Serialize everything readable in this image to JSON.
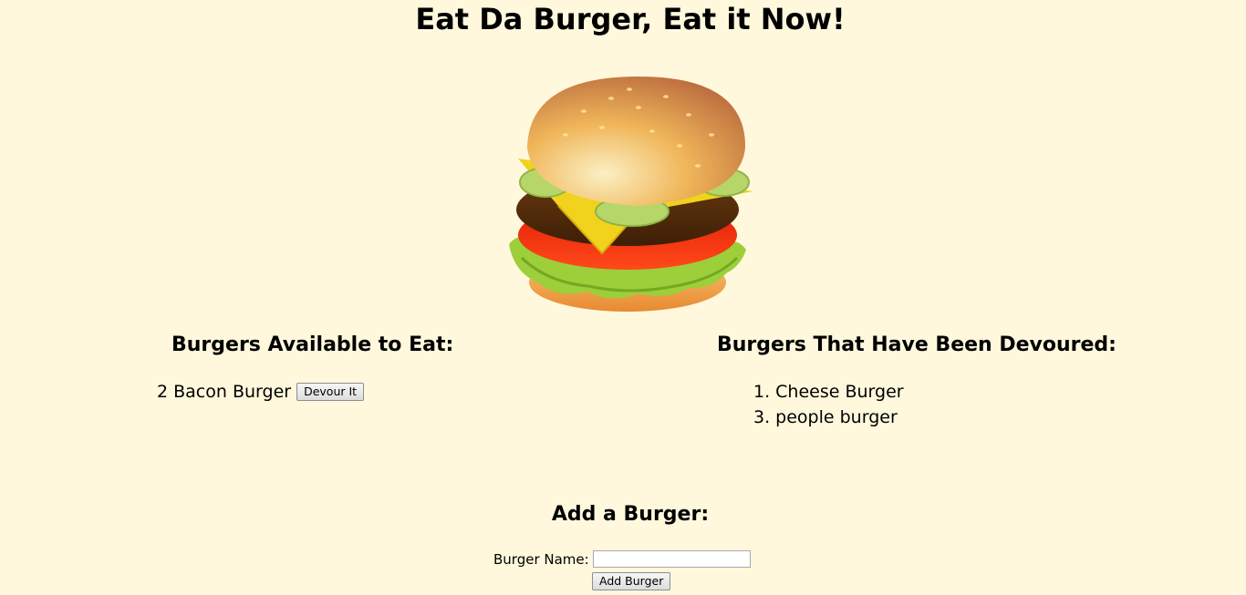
{
  "header": {
    "title": "Eat Da Burger, Eat it Now!"
  },
  "hero": {
    "icon": "burger-icon"
  },
  "available": {
    "heading": "Burgers Available to Eat:",
    "items": [
      {
        "text": "2 Bacon Burger",
        "button": "Devour It"
      }
    ]
  },
  "devoured": {
    "heading": "Burgers That Have Been Devoured:",
    "items": [
      {
        "text": "1. Cheese Burger"
      },
      {
        "text": "3. people burger"
      }
    ]
  },
  "add_form": {
    "heading": "Add a Burger:",
    "name_label": "Burger Name:",
    "name_value": "",
    "submit_label": "Add Burger"
  },
  "colors": {
    "background": "#fff8dc"
  }
}
